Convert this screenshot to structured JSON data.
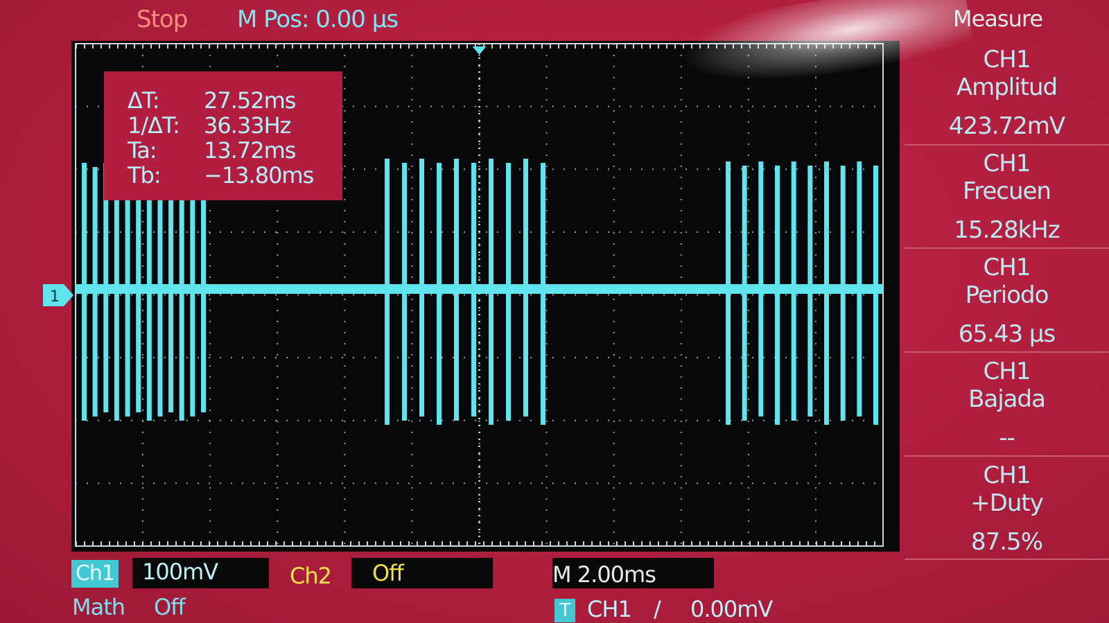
{
  "header": {
    "run_status": "Stop",
    "m_pos_label": "M Pos:",
    "m_pos_value": "0.00 µs"
  },
  "cursors": {
    "rows": [
      {
        "label": "ΔT:",
        "value": "27.52ms"
      },
      {
        "label": "1/ΔT:",
        "value": "36.33Hz"
      },
      {
        "label": "Ta:",
        "value": "13.72ms"
      },
      {
        "label": "Tb:",
        "value": "−13.80ms"
      }
    ]
  },
  "channel_marker": "1",
  "measure": {
    "title": "Measure",
    "items": [
      {
        "channel": "CH1",
        "name": "Amplitud",
        "value": "423.72mV"
      },
      {
        "channel": "CH1",
        "name": "Frecuen",
        "value": "15.28kHz"
      },
      {
        "channel": "CH1",
        "name": "Periodo",
        "value": "65.43 µs"
      },
      {
        "channel": "CH1",
        "name": "Bajada",
        "value": "--"
      },
      {
        "channel": "CH1",
        "name": "+Duty",
        "value": "87.5%"
      }
    ]
  },
  "footer": {
    "ch1_tag": "Ch1",
    "ch1_scale": "100mV",
    "ch2_tag": "Ch2",
    "ch2_state": "Off",
    "timebase": "M 2.00ms",
    "math_label": "Math",
    "math_state": "Off",
    "trigger_tag": "T",
    "trigger_source": "CH1",
    "trigger_slope": "/",
    "trigger_level": "0.00mV"
  },
  "colors": {
    "trace": "#5fe3ec",
    "grid": "#9aa4a8",
    "ch2": "#f1e14a",
    "frame": "#b01e3e"
  }
}
